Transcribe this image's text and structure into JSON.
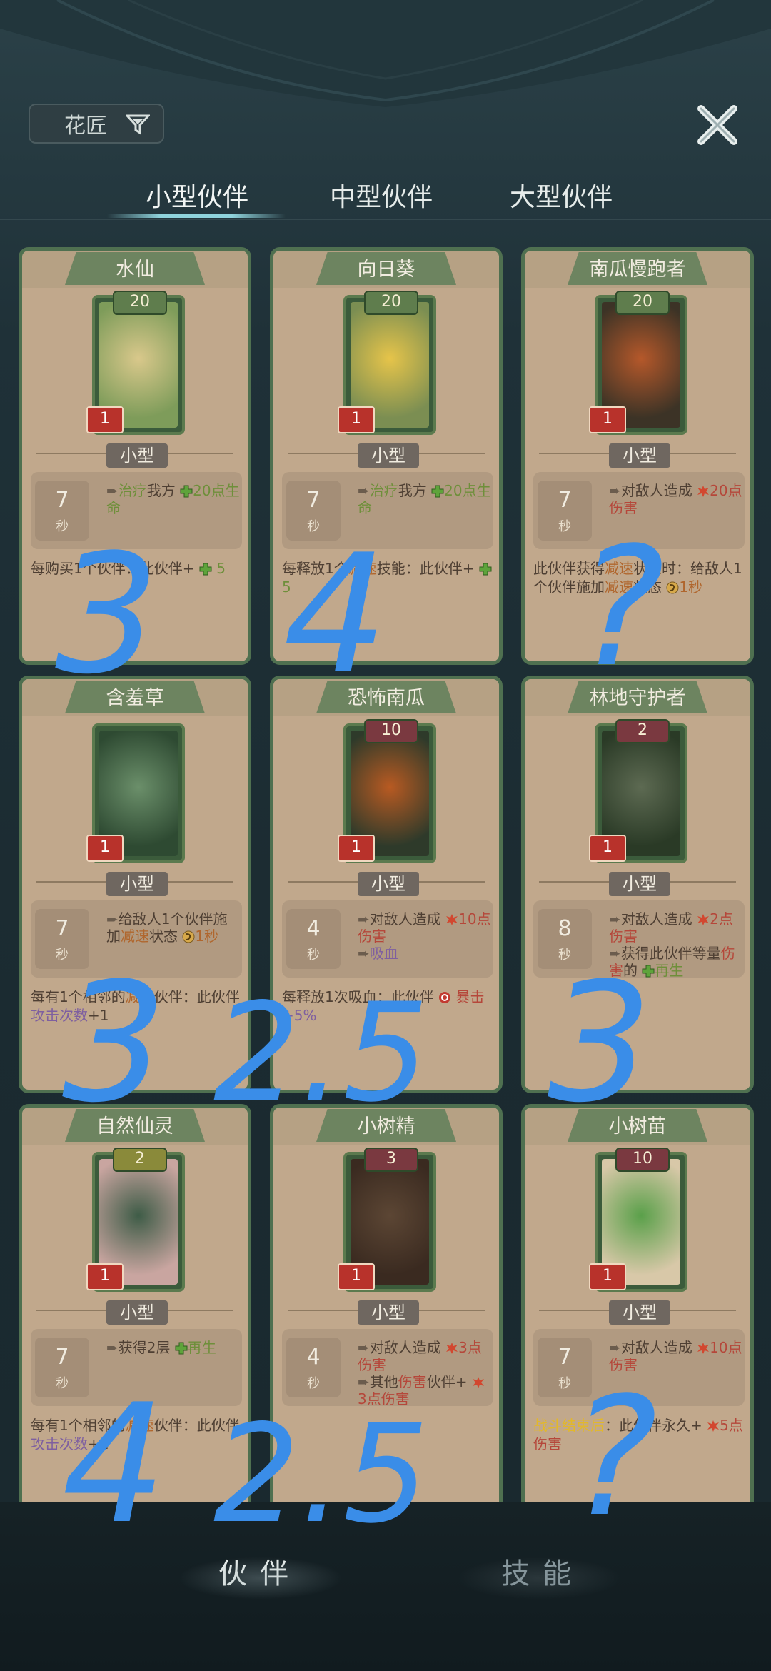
{
  "filter": {
    "label": "花匠"
  },
  "tabs": [
    {
      "label": "小型伙伴",
      "active": true
    },
    {
      "label": "中型伙伴",
      "active": false
    },
    {
      "label": "大型伙伴",
      "active": false
    }
  ],
  "cards": [
    {
      "name": "水仙",
      "level": "20",
      "cost": "1",
      "type": "小型",
      "cooldown": "7",
      "cooldown_unit": "秒",
      "effects": [
        {
          "parts": [
            {
              "t": "治疗",
              "c": "hl-green"
            },
            {
              "t": "我方 "
            },
            {
              "icon": "heal"
            },
            {
              "t": "20点生命",
              "c": "hl-green"
            }
          ]
        }
      ],
      "passive": [
        {
          "t": "每购买1个伙伴：此伙伴+ "
        },
        {
          "icon": "heal"
        },
        {
          "t": " 5",
          "c": "hl-green"
        }
      ]
    },
    {
      "name": "向日葵",
      "level": "20",
      "cost": "1",
      "type": "小型",
      "cooldown": "7",
      "cooldown_unit": "秒",
      "effects": [
        {
          "parts": [
            {
              "t": "治疗",
              "c": "hl-green"
            },
            {
              "t": "我方 "
            },
            {
              "icon": "heal"
            },
            {
              "t": "20点生命",
              "c": "hl-green"
            }
          ]
        }
      ],
      "passive": [
        {
          "t": "每释放1个"
        },
        {
          "t": "减速",
          "c": "hl-orange"
        },
        {
          "t": "技能：此伙伴+ "
        },
        {
          "icon": "heal"
        },
        {
          "t": " 5",
          "c": "hl-green"
        }
      ]
    },
    {
      "name": "南瓜慢跑者",
      "level": "20",
      "cost": "1",
      "type": "小型",
      "cooldown": "7",
      "cooldown_unit": "秒",
      "effects": [
        {
          "parts": [
            {
              "t": "对敌人造成 "
            },
            {
              "icon": "dmg"
            },
            {
              "t": "20点伤害",
              "c": "hl-red"
            }
          ]
        }
      ],
      "passive": [
        {
          "t": "此伙伴获得"
        },
        {
          "t": "减速",
          "c": "hl-orange"
        },
        {
          "t": "状态时：给敌人1个伙伴施加"
        },
        {
          "t": "减速",
          "c": "hl-orange"
        },
        {
          "t": "状态 "
        },
        {
          "icon": "slow"
        },
        {
          "t": "1秒",
          "c": "hl-orange"
        }
      ]
    },
    {
      "name": "含羞草",
      "level": "",
      "cost": "1",
      "type": "小型",
      "cooldown": "7",
      "cooldown_unit": "秒",
      "effects": [
        {
          "parts": [
            {
              "t": "给敌人1个伙伴施加"
            },
            {
              "t": "减速",
              "c": "hl-orange"
            },
            {
              "t": "状态 "
            },
            {
              "icon": "slow"
            },
            {
              "t": "1秒",
              "c": "hl-orange"
            }
          ]
        }
      ],
      "passive": [
        {
          "t": "每有1个相邻的"
        },
        {
          "t": "减速",
          "c": "hl-orange"
        },
        {
          "t": "伙伴：此伙伴"
        },
        {
          "t": "攻击次数",
          "c": "hl-purple"
        },
        {
          "t": "+1"
        }
      ]
    },
    {
      "name": "恐怖南瓜",
      "level": "10",
      "cost": "1",
      "type": "小型",
      "cooldown": "4",
      "cooldown_unit": "秒",
      "effects": [
        {
          "parts": [
            {
              "t": "对敌人造成 "
            },
            {
              "icon": "dmg"
            },
            {
              "t": "10点伤害",
              "c": "hl-red"
            }
          ]
        },
        {
          "parts": [
            {
              "t": "吸血",
              "c": "hl-purple"
            }
          ]
        }
      ],
      "passive": [
        {
          "t": "每释放1次吸血：此伙伴 "
        },
        {
          "icon": "crit"
        },
        {
          "t": " 暴击",
          "c": "hl-red"
        },
        {
          "t": "+5%",
          "c": "hl-purple"
        }
      ]
    },
    {
      "name": "林地守护者",
      "level": "2",
      "cost": "1",
      "type": "小型",
      "cooldown": "8",
      "cooldown_unit": "秒",
      "effects": [
        {
          "parts": [
            {
              "t": "对敌人造成 "
            },
            {
              "icon": "dmg"
            },
            {
              "t": "2点伤害",
              "c": "hl-red"
            }
          ]
        },
        {
          "parts": [
            {
              "t": "获得此伙伴等量"
            },
            {
              "t": "伤害",
              "c": "hl-red"
            },
            {
              "t": "的 "
            },
            {
              "icon": "heal"
            },
            {
              "t": "再生",
              "c": "hl-green"
            }
          ]
        }
      ],
      "passive": []
    },
    {
      "name": "自然仙灵",
      "level": "2",
      "cost": "1",
      "type": "小型",
      "cooldown": "7",
      "cooldown_unit": "秒",
      "effects": [
        {
          "parts": [
            {
              "t": "获得2层 "
            },
            {
              "icon": "heal"
            },
            {
              "t": "再生",
              "c": "hl-green"
            }
          ]
        }
      ],
      "passive": [
        {
          "t": "每有1个相邻的"
        },
        {
          "t": "减速",
          "c": "hl-orange"
        },
        {
          "t": "伙伴：此伙伴"
        },
        {
          "t": "攻击次数",
          "c": "hl-purple"
        },
        {
          "t": "+1"
        }
      ]
    },
    {
      "name": "小树精",
      "level": "3",
      "cost": "1",
      "type": "小型",
      "cooldown": "4",
      "cooldown_unit": "秒",
      "effects": [
        {
          "parts": [
            {
              "t": "对敌人造成 "
            },
            {
              "icon": "dmg"
            },
            {
              "t": "3点伤害",
              "c": "hl-red"
            }
          ]
        },
        {
          "parts": [
            {
              "t": "其他"
            },
            {
              "t": "伤害",
              "c": "hl-red"
            },
            {
              "t": "伙伴+ "
            },
            {
              "icon": "dmg"
            },
            {
              "t": "3点伤害",
              "c": "hl-red"
            }
          ]
        }
      ],
      "passive": []
    },
    {
      "name": "小树苗",
      "level": "10",
      "cost": "1",
      "type": "小型",
      "cooldown": "7",
      "cooldown_unit": "秒",
      "effects": [
        {
          "parts": [
            {
              "t": "对敌人造成 "
            },
            {
              "icon": "dmg"
            },
            {
              "t": "10点伤害",
              "c": "hl-red"
            }
          ]
        }
      ],
      "passive": [
        {
          "t": "战斗结束后",
          "c": "hl-yellow"
        },
        {
          "t": "：此伙伴永久+ "
        },
        {
          "icon": "dmg"
        },
        {
          "t": "5点伤害",
          "c": "hl-red"
        }
      ]
    }
  ],
  "handwriting": [
    "3",
    "4",
    "?",
    "3",
    "2.5",
    "3",
    "4",
    "2.5",
    "?"
  ],
  "bottom_nav": {
    "partner": "伙伴",
    "skill": "技能"
  },
  "colors": {
    "card_bg": "#c1a88c",
    "card_border": "#4f7050",
    "accent_blue": "#3a8de8",
    "heal": "#5ea33b",
    "damage": "#d2472f"
  }
}
